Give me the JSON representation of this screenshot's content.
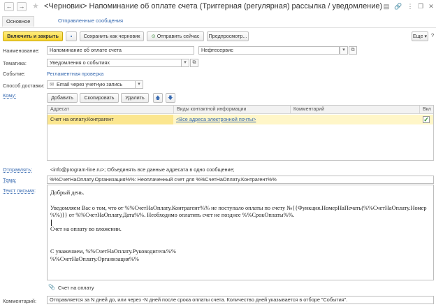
{
  "window": {
    "title": "<Черновик> Напоминание об оплате счета (Триггерная (регулярная) рассылка / уведомление)",
    "back_glyph": "←",
    "forward_glyph": "→",
    "star_glyph": "★",
    "icons": {
      "doc": "▤",
      "link": "🔗",
      "more": "⋮",
      "restore": "❐",
      "close": "✕"
    }
  },
  "tabs": [
    {
      "label": "Основное"
    },
    {
      "label": "Отправленные сообщения"
    }
  ],
  "toolbar": {
    "post_close": "Включить и закрыть",
    "save_icon": "▪",
    "save_draft": "Сохранить как черновик",
    "send_icon": "⊙",
    "send_now": "Отправить сейчас",
    "preview": "Предпросмотр...",
    "more": "Еще ▾",
    "help": "?"
  },
  "form": {
    "name_label": "Наименование:",
    "name_value": "Напоминание об оплате счета",
    "org_value": "Нефтесервис",
    "subject_label": "Тематика:",
    "subject_value": "Уведомления о событиях",
    "event_label": "Событие:",
    "event_value": "Регламентная проверка",
    "delivery_label": "Способ доставки:",
    "delivery_value": "Email через учетную запись",
    "recipients_label": "Кому:"
  },
  "recipients_toolbar": {
    "add": "Добавить",
    "copy": "Скопировать",
    "delete": "Удалить",
    "up": "🡅",
    "down": "🡇"
  },
  "table": {
    "columns": [
      "Адресат",
      "Виды контактной информации",
      "Комментарий",
      "Вкл"
    ],
    "rows": [
      {
        "addressee": "Счет на оплату.Контрагент",
        "contact_type": "<Все адреса электронной почты>",
        "comment": "",
        "enabled": "✓"
      }
    ]
  },
  "sender": {
    "label": "Отправлять:",
    "value": "<info@program-line.ru>; Объединять все данные адресата в одно сообщение;"
  },
  "topic": {
    "label": "Тема:",
    "value": "%%СчетНаОплату.Организация%%: Неоплаченный счет для %%СчетНаОплату.Контрагент%%"
  },
  "letter": {
    "label": "Текст письма:",
    "lines": [
      "Добрый день.",
      "Уведомляем Вас о том, что от %%СчетНаОплату.Контрагент%% не поступало оплаты по счету №{{Функция.НомерНаПечать(%%СчетНаОплату.Номер",
      "%%)}} от %%СчетНаОплату.Дата%%. Необходимо оплатить счет не позднее %%СрокОплаты%%.",
      "Счет на оплату во вложении.",
      "С уважением, %%СчетНаОплату.Руководитель%%",
      "%%СчетНаОплату.Организация%%"
    ]
  },
  "attachment": {
    "icon": "📎",
    "label": "Счет на оплату"
  },
  "comment": {
    "label": "Комментарий:",
    "value": "Отправляется за N дней до, или через -N дней после срока оплаты счета. Количество дней указывается в отборе \"События\"."
  }
}
